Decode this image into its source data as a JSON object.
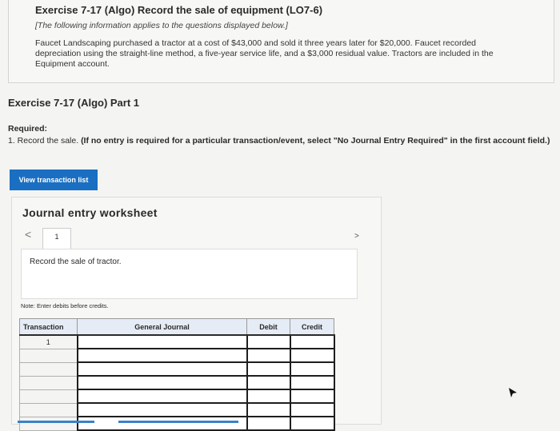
{
  "exercise": {
    "title": "Exercise 7-17 (Algo) Record the sale of equipment (LO7-6)",
    "applies": "[The following information applies to the questions displayed below.]",
    "problem": "Faucet Landscaping purchased a tractor at a cost of $43,000 and sold it three years later for $20,000. Faucet recorded depreciation using the straight-line method, a five-year service life, and a $3,000 residual value. Tractors are included in the Equipment account."
  },
  "part": {
    "title": "Exercise 7-17 (Algo) Part 1"
  },
  "required": {
    "label": "Required:",
    "text": "1. Record the sale.",
    "instruction": "(If no entry is required for a particular transaction/event, select \"No Journal Entry Required\" in the first account field.)"
  },
  "buttons": {
    "view_transaction_list": "View transaction list"
  },
  "worksheet": {
    "title": "Journal entry worksheet",
    "prev": "<",
    "next": ">",
    "page": "1",
    "entry_description": "Record the sale of tractor.",
    "note": "Note: Enter debits before credits."
  },
  "table": {
    "headers": {
      "transaction": "Transaction",
      "account": "General Journal",
      "debit": "Debit",
      "credit": "Credit"
    },
    "rows": [
      {
        "transaction": "1",
        "account": "",
        "debit": "",
        "credit": ""
      },
      {
        "transaction": "",
        "account": "",
        "debit": "",
        "credit": ""
      },
      {
        "transaction": "",
        "account": "",
        "debit": "",
        "credit": ""
      },
      {
        "transaction": "",
        "account": "",
        "debit": "",
        "credit": ""
      },
      {
        "transaction": "",
        "account": "",
        "debit": "",
        "credit": ""
      },
      {
        "transaction": "",
        "account": "",
        "debit": "",
        "credit": ""
      },
      {
        "transaction": "",
        "account": "",
        "debit": "",
        "credit": ""
      }
    ]
  },
  "colors": {
    "accent": "#1a6fc2",
    "header_bg": "#e6ecf5"
  }
}
